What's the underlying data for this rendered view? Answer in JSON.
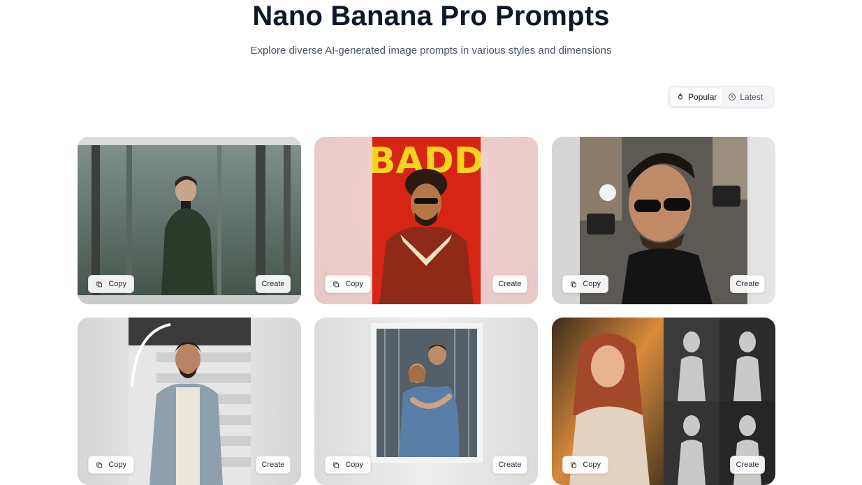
{
  "header": {
    "title": "Nano Banana Pro Prompts",
    "subtitle": "Explore diverse AI-generated image prompts in various styles and dimensions"
  },
  "sort": {
    "options": [
      {
        "label": "Popular",
        "icon": "flame-icon",
        "active": true
      },
      {
        "label": "Latest",
        "icon": "clock-icon",
        "active": false
      }
    ]
  },
  "cards": [
    {
      "copy_label": "Copy",
      "create_label": "Create",
      "image": "man-in-misty-forest",
      "poster_text": ""
    },
    {
      "copy_label": "Copy",
      "create_label": "Create",
      "image": "retro-poster-man-red-jacket",
      "poster_text": "BADD"
    },
    {
      "copy_label": "Copy",
      "create_label": "Create",
      "image": "man-sunglasses-paparazzi",
      "poster_text": ""
    },
    {
      "copy_label": "Copy",
      "create_label": "Create",
      "image": "man-plaid-shirt-staircase",
      "poster_text": ""
    },
    {
      "copy_label": "Copy",
      "create_label": "Create",
      "image": "couple-polaroid-hug",
      "poster_text": ""
    },
    {
      "copy_label": "Copy",
      "create_label": "Create",
      "image": "woman-portrait-collage",
      "poster_text": ""
    }
  ]
}
